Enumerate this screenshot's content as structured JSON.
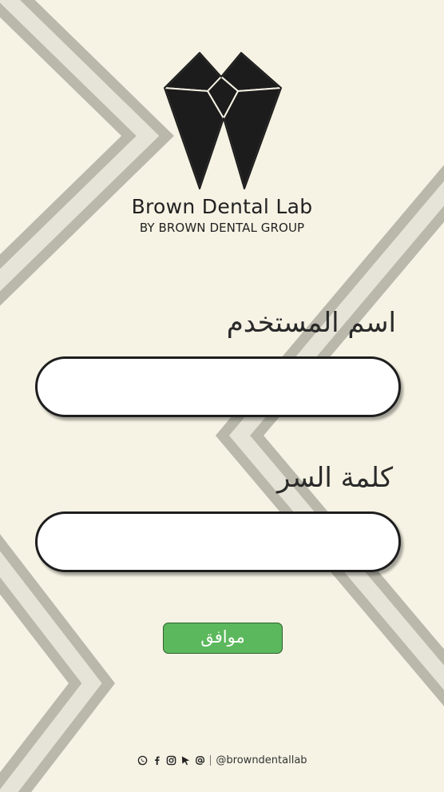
{
  "brand": {
    "name": "Brown Dental Lab",
    "tagline": "BY BROWN DENTAL GROUP"
  },
  "form": {
    "username_label": "اسم المستخدم",
    "username_value": "",
    "password_label": "كلمة السر",
    "password_value": "",
    "submit_label": "موافق"
  },
  "footer": {
    "icons": [
      "whatsapp-icon",
      "facebook-icon",
      "instagram-icon",
      "cursor-icon",
      "at-icon"
    ],
    "handle": "@browndentallab"
  },
  "colors": {
    "background": "#f6f3e4",
    "stripe_dark": "#b9b8ab",
    "stripe_light": "#e6e4d8",
    "button_green": "#5cb85c",
    "logo_black": "#1c1c1c"
  }
}
